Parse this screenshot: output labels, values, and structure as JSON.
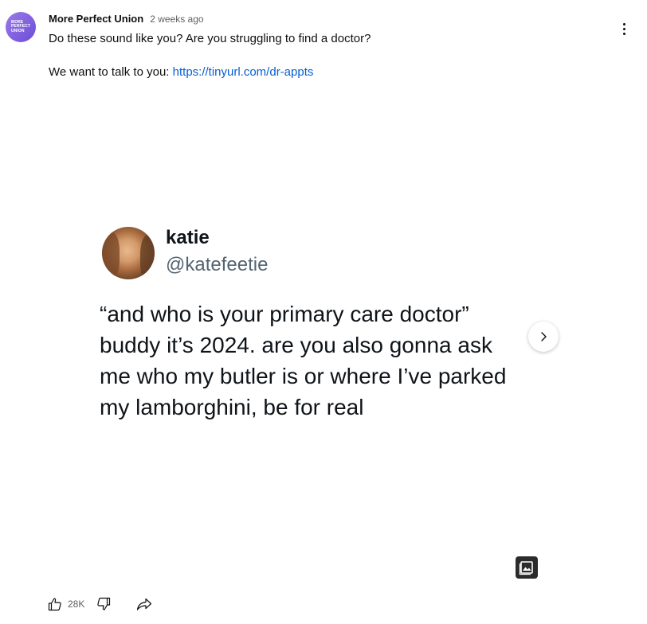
{
  "post": {
    "channel_name": "More Perfect Union",
    "timestamp": "2 weeks ago",
    "avatar_text": [
      "MORE",
      "PERFECT",
      "UNION"
    ],
    "text_line1": "Do these sound like you? Are you struggling to find a doctor?",
    "text_line2_prefix": "We want to talk to you: ",
    "link": "https://tinyurl.com/dr-appts"
  },
  "tweet": {
    "name": "katie",
    "handle": "@katefeetie",
    "body": "“and who is your primary care doctor” buddy it’s 2024. are you also gonna ask me who my butler is or where I’ve parked my lamborghini, be for real"
  },
  "actions": {
    "like_count": "28K"
  },
  "icons": {
    "menu": "more-vert-icon",
    "next": "chevron-right-icon",
    "gallery": "image-gallery-icon",
    "like": "thumbs-up-icon",
    "dislike": "thumbs-down-icon",
    "share": "share-icon"
  },
  "colors": {
    "link": "#065fd4",
    "avatar": "#7b5ce0"
  }
}
